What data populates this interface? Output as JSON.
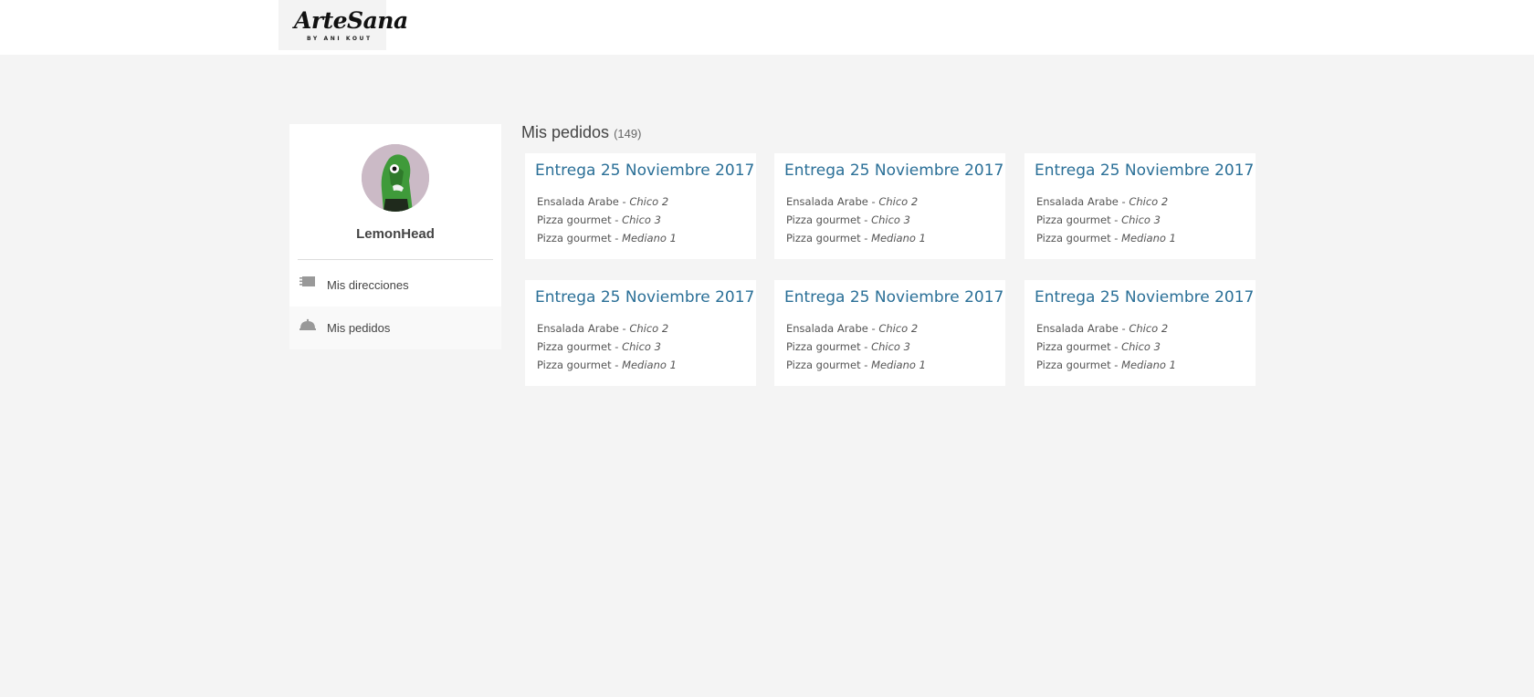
{
  "brand": {
    "name": "ArteSana",
    "tagline": "BY ANI KOUT"
  },
  "profile": {
    "username": "LemonHead"
  },
  "menu": [
    {
      "label": "Mis direcciones",
      "icon": "address-book-icon",
      "active": false
    },
    {
      "label": "Mis pedidos",
      "icon": "food-dome-icon",
      "active": true
    }
  ],
  "orders": {
    "title": "Mis pedidos",
    "count": "(149)",
    "cards": [
      {
        "title": "Entrega 25 Noviembre 2017",
        "items": [
          {
            "name": "Ensalada Arabe - ",
            "size": "Chico 2"
          },
          {
            "name": "Pizza gourmet - ",
            "size": "Chico 3"
          },
          {
            "name": "Pizza gourmet - ",
            "size": "Mediano 1"
          }
        ]
      },
      {
        "title": "Entrega 25 Noviembre 2017",
        "items": [
          {
            "name": "Ensalada Arabe - ",
            "size": "Chico 2"
          },
          {
            "name": "Pizza gourmet - ",
            "size": "Chico 3"
          },
          {
            "name": "Pizza gourmet - ",
            "size": "Mediano 1"
          }
        ]
      },
      {
        "title": "Entrega 25 Noviembre 2017",
        "items": [
          {
            "name": "Ensalada Arabe - ",
            "size": "Chico 2"
          },
          {
            "name": "Pizza gourmet - ",
            "size": "Chico 3"
          },
          {
            "name": "Pizza gourmet - ",
            "size": "Mediano 1"
          }
        ]
      },
      {
        "title": "Entrega 25 Noviembre 2017",
        "items": [
          {
            "name": "Ensalada Arabe - ",
            "size": "Chico 2"
          },
          {
            "name": "Pizza gourmet - ",
            "size": "Chico 3"
          },
          {
            "name": "Pizza gourmet - ",
            "size": "Mediano 1"
          }
        ]
      },
      {
        "title": "Entrega 25 Noviembre 2017",
        "items": [
          {
            "name": "Ensalada Arabe - ",
            "size": "Chico 2"
          },
          {
            "name": "Pizza gourmet - ",
            "size": "Chico 3"
          },
          {
            "name": "Pizza gourmet - ",
            "size": "Mediano 1"
          }
        ]
      },
      {
        "title": "Entrega 25 Noviembre 2017",
        "items": [
          {
            "name": "Ensalada Arabe - ",
            "size": "Chico 2"
          },
          {
            "name": "Pizza gourmet - ",
            "size": "Chico 3"
          },
          {
            "name": "Pizza gourmet - ",
            "size": "Mediano 1"
          }
        ]
      }
    ]
  },
  "colors": {
    "background": "#f4f4f4",
    "card_title": "#2a6f97",
    "avatar_bg": "#cbbac6",
    "avatar_figure": "#3f9a3a"
  }
}
